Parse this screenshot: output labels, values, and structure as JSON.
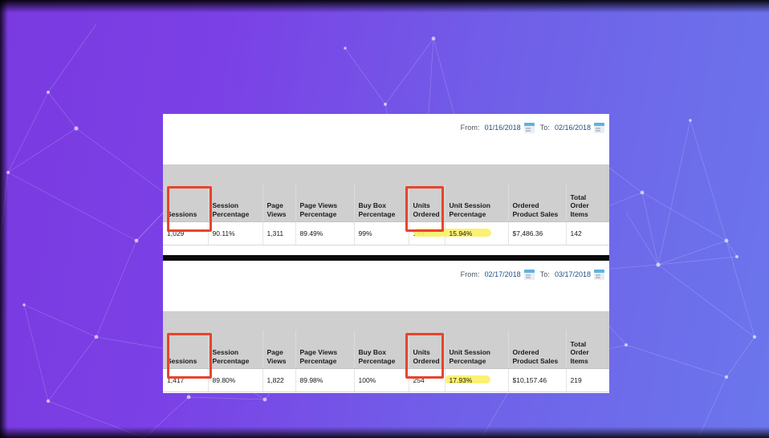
{
  "background": {
    "gradient_from": "#7a3ae0",
    "gradient_to": "#6b76ec",
    "pattern": "constellation-network"
  },
  "panel": {
    "divider_color": "#0a0a0a",
    "annotation_color": "#e8442c",
    "highlight_color": "#fbf06a"
  },
  "columns": [
    "Sessions",
    "Session Percentage",
    "Page Views",
    "Page Views Percentage",
    "Buy Box Percentage",
    "Units Ordered",
    "Unit Session Percentage",
    "Ordered Product Sales",
    "Total Order Items"
  ],
  "reports": [
    {
      "date_range": {
        "from_label": "From:",
        "from_value": "01/16/2018",
        "to_label": "To:",
        "to_value": "02/16/2018",
        "from_icon": "calendar-icon",
        "to_icon": "calendar-icon"
      },
      "row": {
        "sessions": "1,029",
        "session_percentage": "90.11%",
        "page_views": "1,311",
        "page_views_percentage": "89.49%",
        "buy_box_percentage": "99%",
        "units_ordered": "164",
        "unit_session_percentage": "15.94%",
        "ordered_product_sales": "$7,486.36",
        "total_order_items": "142"
      }
    },
    {
      "date_range": {
        "from_label": "From:",
        "from_value": "02/17/2018",
        "to_label": "To:",
        "to_value": "03/17/2018",
        "from_icon": "calendar-icon",
        "to_icon": "calendar-icon"
      },
      "row": {
        "sessions": "1,417",
        "session_percentage": "89.80%",
        "page_views": "1,822",
        "page_views_percentage": "89.98%",
        "buy_box_percentage": "100%",
        "units_ordered": "254",
        "unit_session_percentage": "17.93%",
        "ordered_product_sales": "$10,157.46",
        "total_order_items": "219"
      }
    }
  ]
}
